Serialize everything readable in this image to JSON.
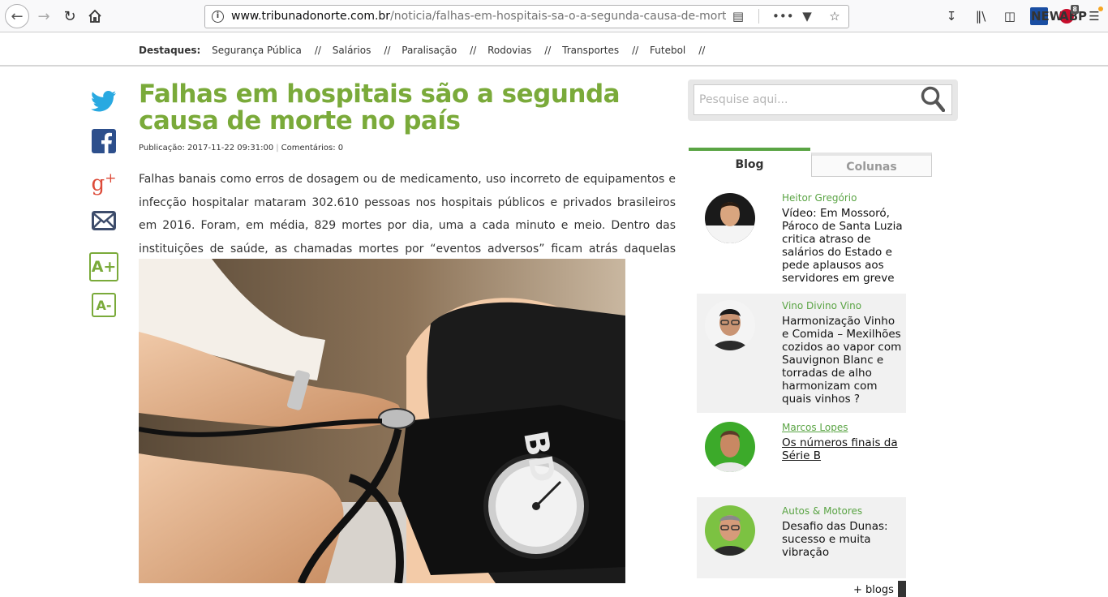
{
  "browser": {
    "url_host": "www.tribunadonorte.com.br",
    "url_path": "/noticia/falhas-em-hospitais-sa-o-a-segunda-causa-de-morte-no",
    "abp_count": "8"
  },
  "destaques": {
    "label": "Destaques:",
    "links": [
      "Segurança Pública",
      "Salários",
      "Paralisação",
      "Rodovias",
      "Transportes",
      "Futebol"
    ],
    "separator": "//"
  },
  "share": {
    "font_increase": "A+",
    "font_decrease": "A-"
  },
  "article": {
    "title": "Falhas em hospitais são a segunda causa de morte no país",
    "published_label": "Publicação: 2017-11-22 09:31:00",
    "comments_label": "Comentários: 0",
    "body": "Falhas banais como erros de dosagem ou de medicamento, uso incorreto de equipamentos e infecção hospitalar mataram 302.610 pessoas nos hospitais públicos e privados brasileiros em 2016. Foram, em média, 829 mortes por dia, uma a cada minuto e meio. Dentro das instituições de saúde, as chamadas mortes por “eventos adversos” ficam atrás daquelas provocadas por problemas no coração."
  },
  "sidebar": {
    "search_placeholder": "Pesquise aqui...",
    "tabs": {
      "blog": "Blog",
      "colunas": "Colunas"
    },
    "blogs": [
      {
        "author": "Heitor Gregório",
        "title": "Vídeo: Em Mossoró, Pároco de Santa Luzia critica atraso de salários do Estado e pede aplausos aos servidores em greve"
      },
      {
        "author": "Vino Divino Vino",
        "title": "Harmonização Vinho e Comida – Mexilhões cozidos ao vapor com Sauvignon Blanc e torradas de alho harmonizam com quais vinhos ?"
      },
      {
        "author": "Marcos Lopes",
        "title": "Os números finais da Série B"
      },
      {
        "author": "Autos & Motores",
        "title": "Desafio das Dunas: sucesso e muita vibração"
      }
    ],
    "more_blogs": "+ blogs"
  },
  "colors": {
    "accent_green": "#7aaa3a",
    "blog_green": "#5aa444"
  }
}
